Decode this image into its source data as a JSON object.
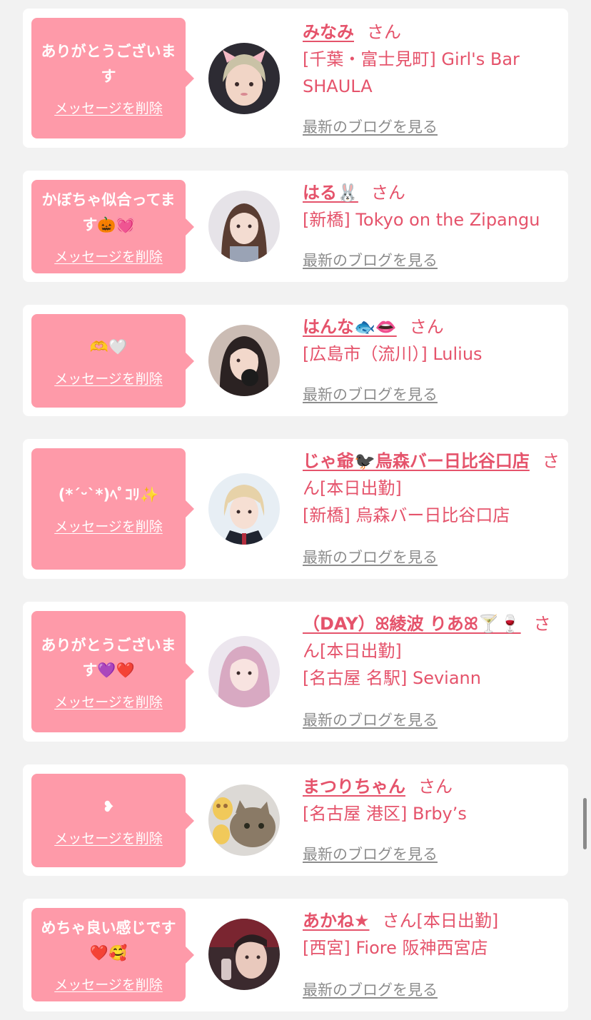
{
  "colors": {
    "bubble": "#fe9aa9",
    "accent": "#e5536b",
    "muted": "#8c8c8c",
    "background": "#f2f2f2"
  },
  "labels": {
    "san": "さん",
    "delete": "メッセージを削除",
    "blog": "最新のブログを見る"
  },
  "items": [
    {
      "message": "ありがとうございます",
      "name": "みなみ",
      "status": "",
      "shop": "[千葉・富士見町] Girl's Bar SHAULA",
      "avatar_icon": "girl-photo"
    },
    {
      "message": "かぼちゃ似合ってます🎃💓",
      "name": "はる🐰",
      "status": "",
      "shop": "[新橋] Tokyo on the Zipangu",
      "avatar_icon": "girl-photo"
    },
    {
      "message": "🫶🤍",
      "name": "はんな🐟👄",
      "status": "",
      "shop": "[広島市（流川）] Lulius",
      "avatar_icon": "girl-photo"
    },
    {
      "message": "(*ˊᵕˋ*)ﾍﾟｺﾘ✨",
      "name": "じゃ爺🐦‍⬛烏森バー日比谷口店",
      "status": "[本日出勤]",
      "shop": "[新橋] 烏森バー日比谷口店",
      "avatar_icon": "girl-photo"
    },
    {
      "message": "ありがとうございます💜❤️",
      "name": "（DAY）ꕤ綾波 りあꕤ🍸🍷",
      "status": "[本日出勤]",
      "shop": "[名古屋 名駅] Seviann",
      "avatar_icon": "girl-photo"
    },
    {
      "message": "❥",
      "name": "まつりちゃん",
      "status": "",
      "shop": "[名古屋 港区] Brby’s",
      "avatar_icon": "cat-photo"
    },
    {
      "message": "めちゃ良い感じです❤️🥰",
      "name": "あかね★",
      "status": "[本日出勤]",
      "shop": "[西宮] Fiore 阪神西宮店",
      "avatar_icon": "girl-photo"
    }
  ]
}
